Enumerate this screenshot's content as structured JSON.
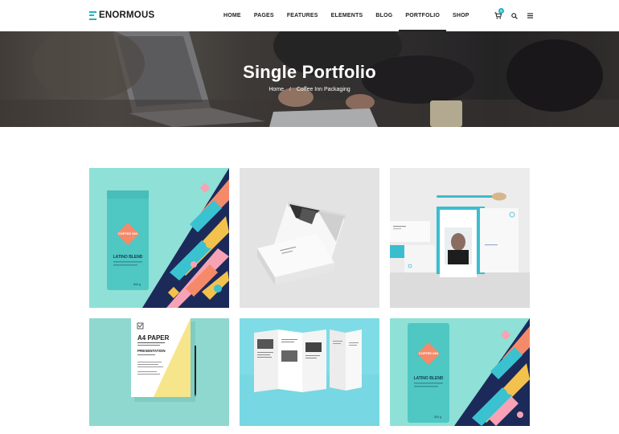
{
  "brand": {
    "name": "ENORMOUS",
    "accent": "#1fb3c9"
  },
  "nav": {
    "items": [
      {
        "label": "HOME",
        "active": false
      },
      {
        "label": "PAGES",
        "active": false
      },
      {
        "label": "FEATURES",
        "active": false
      },
      {
        "label": "ELEMENTS",
        "active": false
      },
      {
        "label": "BLOG",
        "active": false
      },
      {
        "label": "PORTFOLIO",
        "active": true
      },
      {
        "label": "SHOP",
        "active": false
      }
    ]
  },
  "header_icons": {
    "cart": "cart-icon",
    "cart_count": "0",
    "search": "search-icon",
    "menu": "menu-icon"
  },
  "hero": {
    "title": "Single Portfolio",
    "breadcrumb": {
      "home": "Home",
      "separator": "/",
      "current": "Coffee Inn Packaging"
    }
  },
  "portfolio": {
    "items": [
      {
        "name": "coffee-bag-pattern",
        "bag_brand": "COFFEE INN",
        "bag_title": "LATINO BLEND",
        "bag_weight": "500 g"
      },
      {
        "name": "business-cards"
      },
      {
        "name": "stationery-set"
      },
      {
        "name": "a4-paper",
        "paper_title": "A4 PAPER",
        "paper_sub": "PRESENTATION"
      },
      {
        "name": "trifold-brochure"
      },
      {
        "name": "coffee-bag-pattern-2",
        "bag_brand": "COFFEE INN",
        "bag_title": "LATINO BLEND",
        "bag_weight": "500 g"
      }
    ]
  }
}
